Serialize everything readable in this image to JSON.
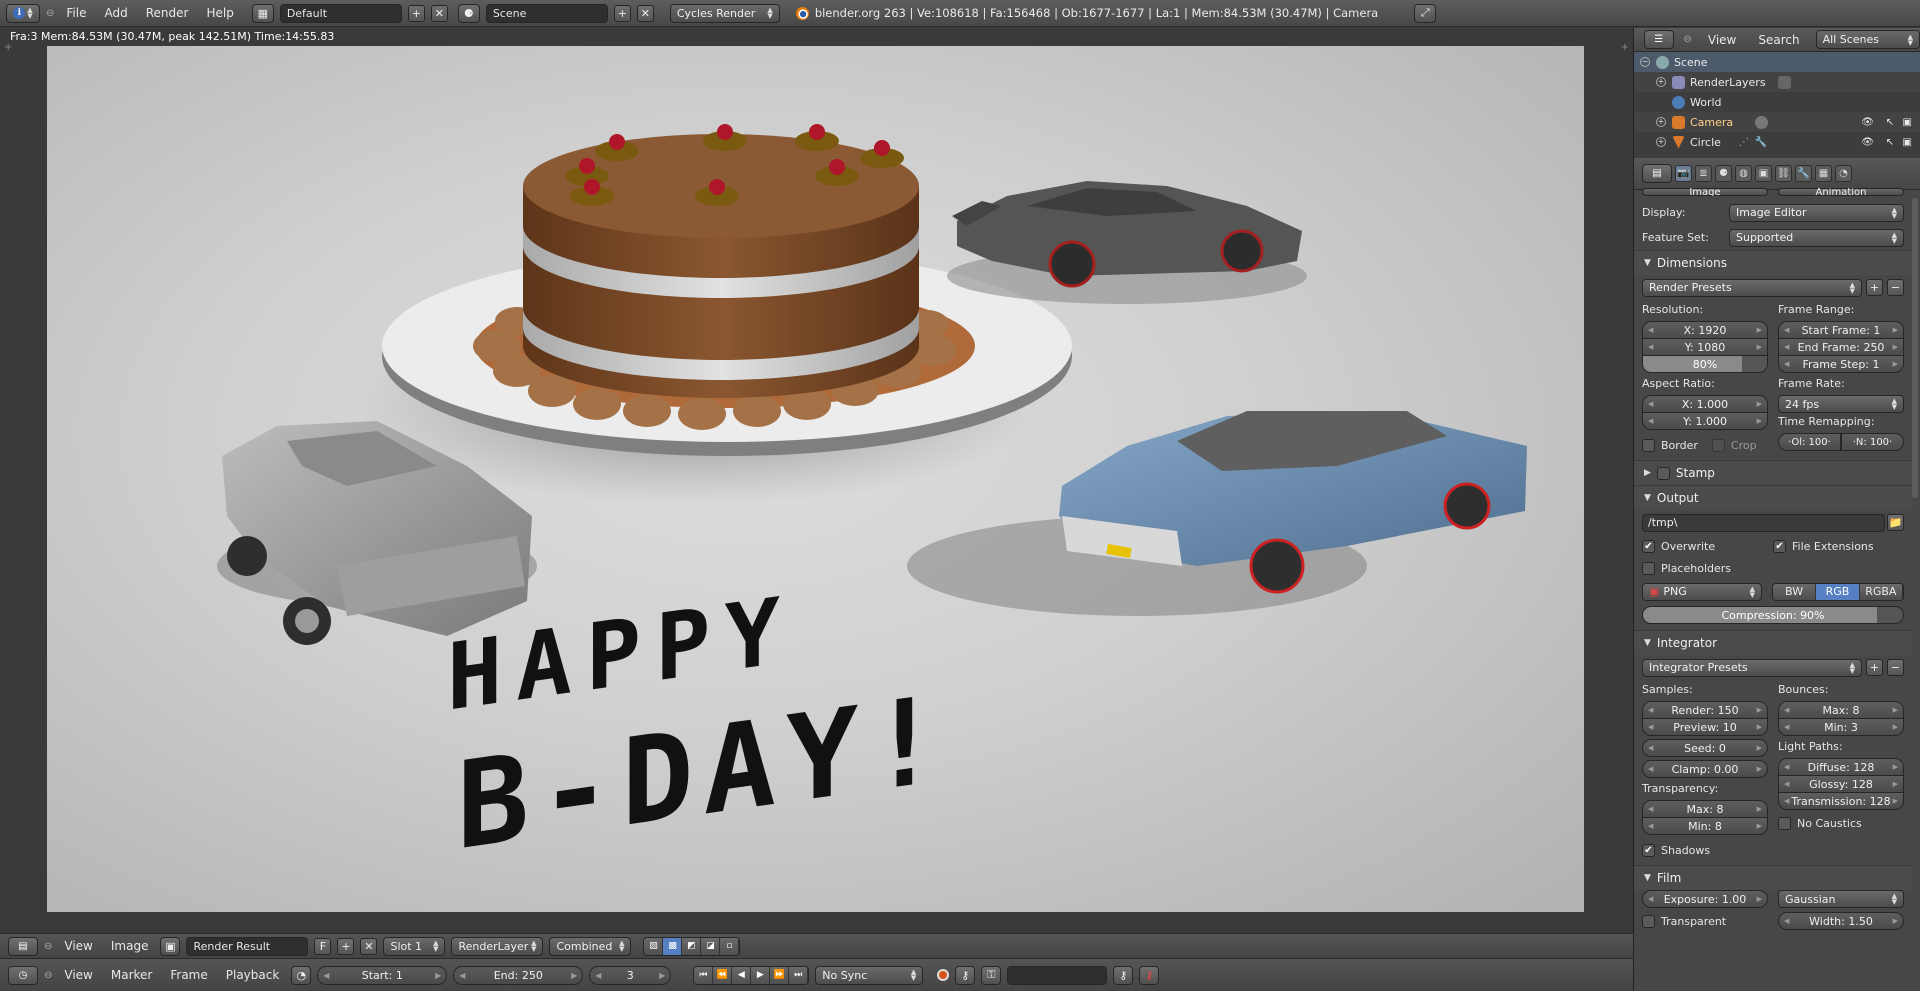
{
  "topbar": {
    "menus": [
      "File",
      "Add",
      "Render",
      "Help"
    ],
    "screen_layout": "Default",
    "scene": "Scene",
    "render_engine": "Cycles Render",
    "stats": "blender.org 263 | Ve:108618 | Fa:156468 | Ob:1677-1677 | La:1 | Mem:84.53M (30.47M) | Camera"
  },
  "image_editor": {
    "render_info": "Fra:3  Mem:84.53M (30.47M, peak 142.51M) Time:14:55.83"
  },
  "image_header": {
    "menus": [
      "View",
      "Image"
    ],
    "image_name": "Render Result",
    "fake_user": "F",
    "slot": "Slot 1",
    "render_layer": "RenderLayer",
    "pass": "Combined"
  },
  "timeline": {
    "menus": [
      "View",
      "Marker",
      "Frame",
      "Playback"
    ],
    "start": "Start: 1",
    "end": "End: 250",
    "current": "3",
    "sync": "No Sync"
  },
  "outliner": {
    "menus": [
      "View",
      "Search"
    ],
    "filter": "All Scenes",
    "items": [
      "Scene",
      "RenderLayers",
      "World",
      "Camera",
      "Circle"
    ]
  },
  "properties": {
    "partial_tabs": [
      "Image",
      "Animation"
    ],
    "display_label": "Display:",
    "display_value": "Image Editor",
    "feature_set_label": "Feature Set:",
    "feature_set_value": "Supported",
    "dimensions": {
      "title": "Dimensions",
      "presets": "Render Presets",
      "resolution_label": "Resolution:",
      "res_x": "X: 1920",
      "res_y": "Y: 1080",
      "res_pct": "80%",
      "res_pct_value": 80,
      "frame_range_label": "Frame Range:",
      "start_frame": "Start Frame: 1",
      "end_frame": "End Frame: 250",
      "frame_step": "Frame Step: 1",
      "aspect_label": "Aspect Ratio:",
      "aspect_x": "X: 1.000",
      "aspect_y": "Y: 1.000",
      "frame_rate_label": "Frame Rate:",
      "frame_rate": "24 fps",
      "time_remap_label": "Time Remapping:",
      "remap_old": "·Ol: 100·",
      "remap_new": "·N: 100·",
      "border": "Border",
      "crop": "Crop"
    },
    "stamp": {
      "title": "Stamp"
    },
    "output": {
      "title": "Output",
      "path": "/tmp\\",
      "overwrite": "Overwrite",
      "file_extensions": "File Extensions",
      "placeholders": "Placeholders",
      "format": "PNG",
      "color_modes": [
        "BW",
        "RGB",
        "RGBA"
      ],
      "selected_color_mode": "RGB",
      "compression": "Compression: 90%",
      "compression_value": 90
    },
    "integrator": {
      "title": "Integrator",
      "presets": "Integrator Presets",
      "samples_label": "Samples:",
      "render": "Render: 150",
      "preview": "Preview: 10",
      "seed": "Seed: 0",
      "clamp": "Clamp: 0.00",
      "bounces_label": "Bounces:",
      "max_bounce": "Max: 8",
      "min_bounce": "Min: 3",
      "light_paths_label": "Light Paths:",
      "diffuse": "Diffuse: 128",
      "glossy": "Glossy: 128",
      "transmission": "Transmission: 128",
      "transparency_label": "Transparency:",
      "t_max": "Max: 8",
      "t_min": "Min: 8",
      "no_caustics": "No Caustics",
      "shadows": "Shadows"
    },
    "film": {
      "title": "Film",
      "exposure": "Exposure: 1.00",
      "filter": "Gaussian",
      "transparent": "Transparent",
      "width": "Width: 1.50"
    }
  },
  "render_text": {
    "line1": "HAPPY",
    "line2": "B-DAY!"
  },
  "colors": {
    "accent_blue": "#5680c2",
    "cake_chocolate": "#7a4a26",
    "car_blue": "#6d8fb0",
    "cherry": "#b0162a"
  }
}
